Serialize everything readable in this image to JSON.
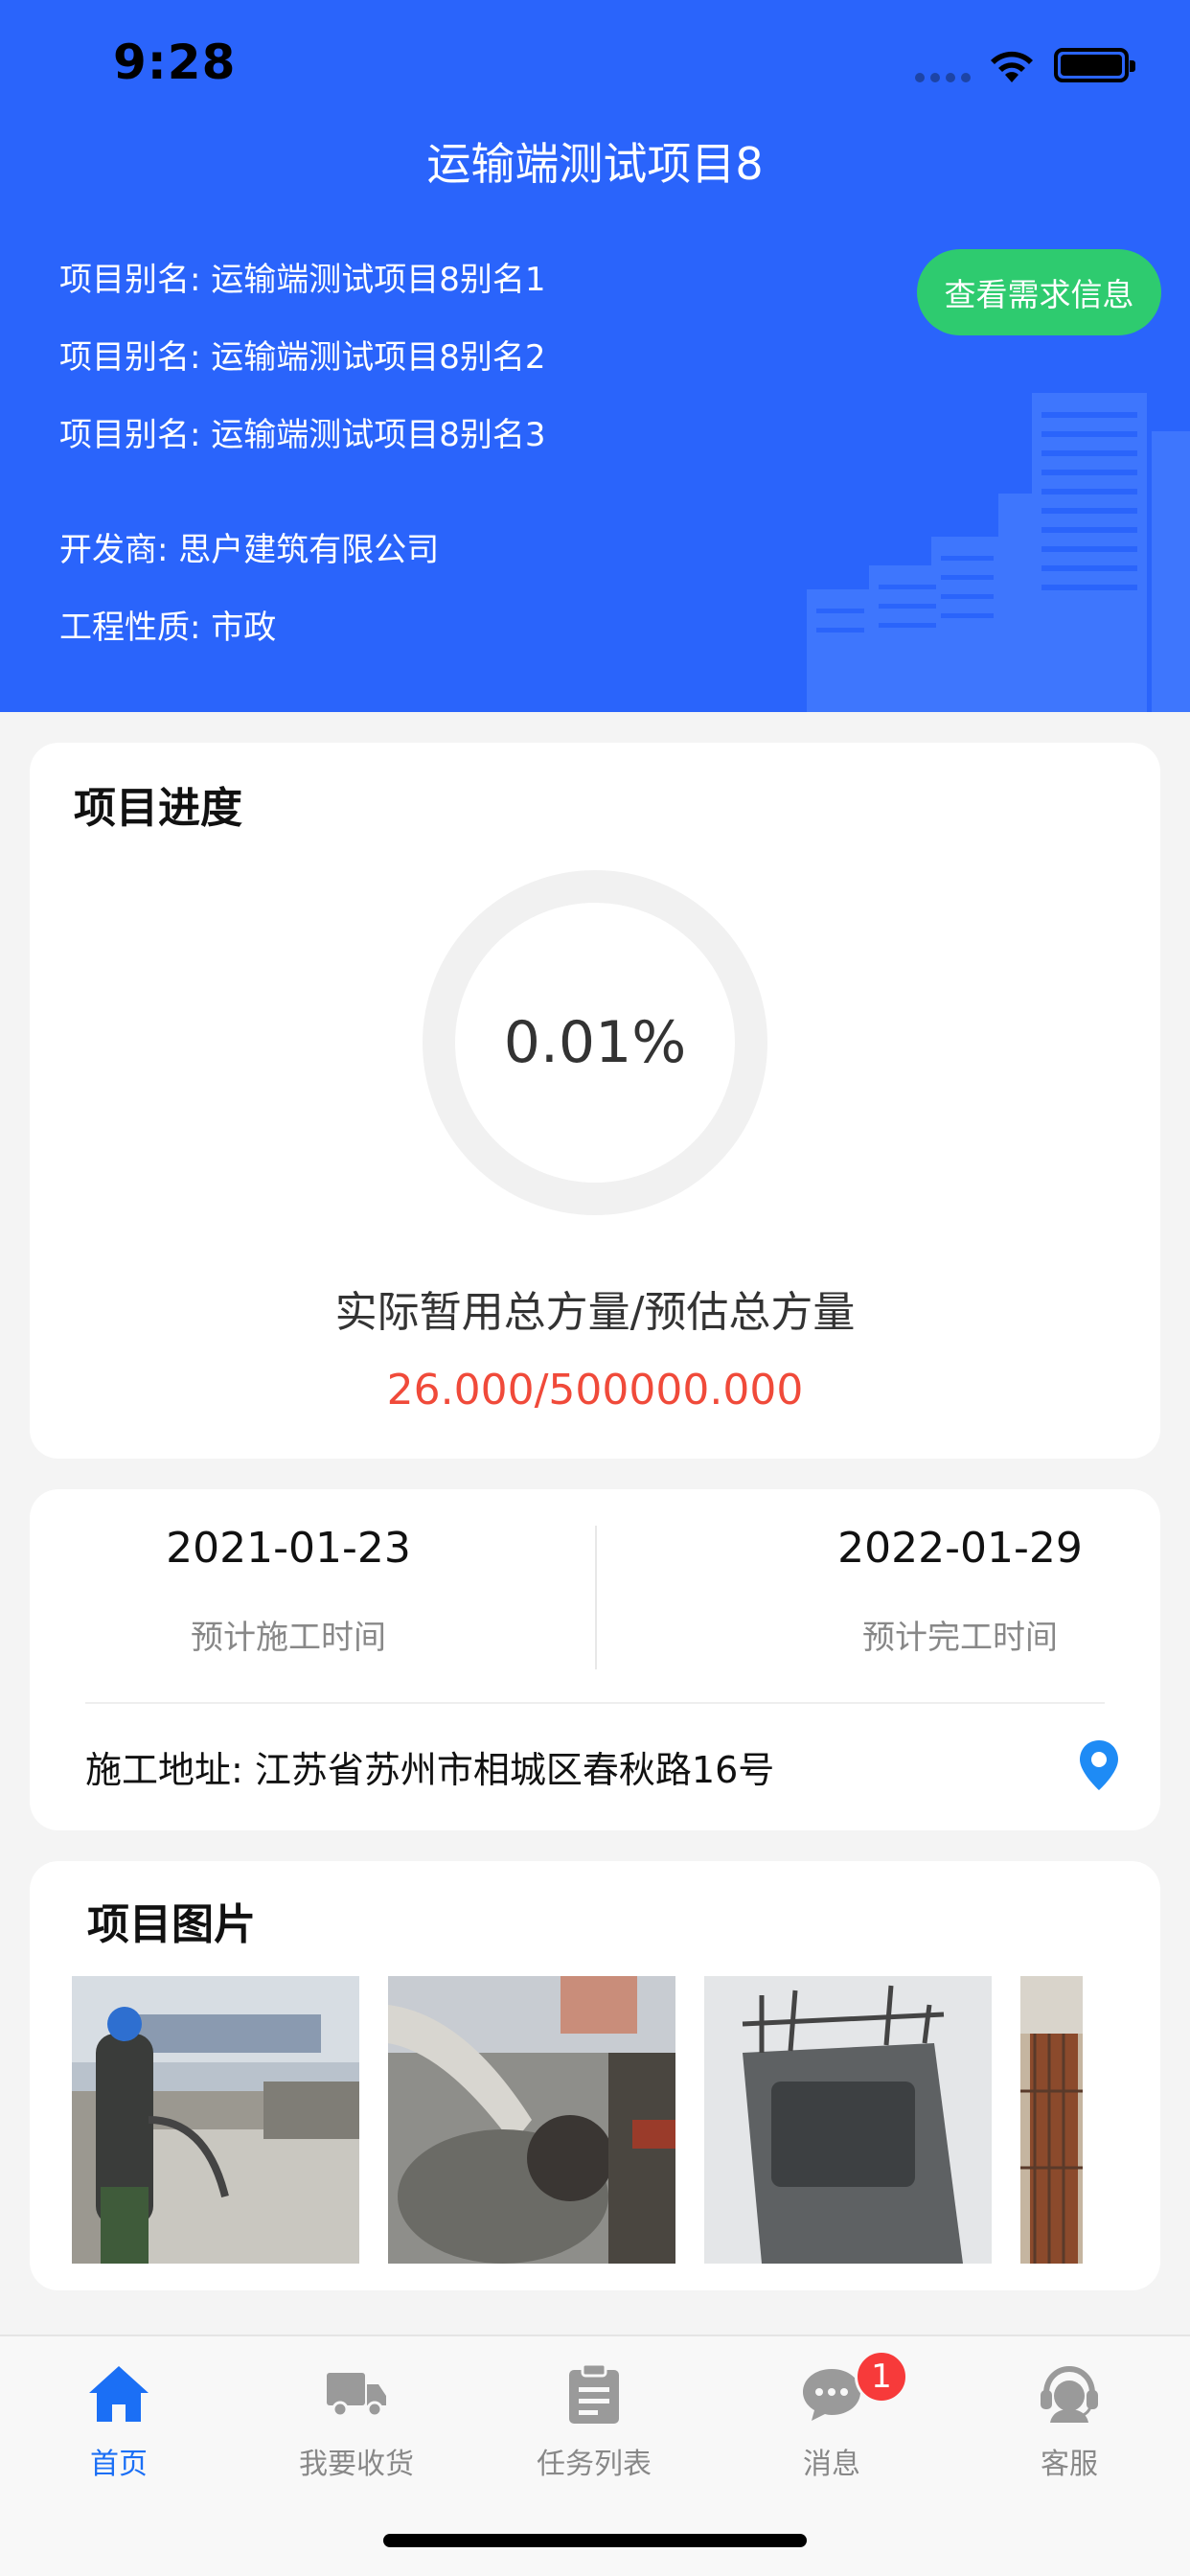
{
  "status_bar": {
    "time": "9:28"
  },
  "header": {
    "title": "运输端测试项目8",
    "aliases": [
      {
        "label": "项目别名:",
        "value": "运输端测试项目8别名1"
      },
      {
        "label": "项目别名:",
        "value": "运输端测试项目8别名2"
      },
      {
        "label": "项目别名:",
        "value": "运输端测试项目8别名3"
      }
    ],
    "developer": {
      "label": "开发商:",
      "value": "思户建筑有限公司"
    },
    "nature": {
      "label": "工程性质:",
      "value": "市政"
    },
    "demand_button": "查看需求信息",
    "accent_color": "#2a64fb"
  },
  "progress": {
    "title": "项目进度",
    "percent_text": "0.01%",
    "ratio_label": "实际暂用总方量/预估总方量",
    "ratio_value": "26.000/500000.000"
  },
  "schedule": {
    "start_date": "2021-01-23",
    "start_label": "预计施工时间",
    "end_date": "2022-01-29",
    "end_label": "预计完工时间",
    "address_label": "施工地址:",
    "address_value": "江苏省苏州市相城区春秋路16号",
    "pin_icon": "location-pin-icon"
  },
  "photos": {
    "title": "项目图片",
    "items": [
      {
        "name": "photo-worker-pouring"
      },
      {
        "name": "photo-concrete-pump"
      },
      {
        "name": "photo-precast-pier"
      },
      {
        "name": "photo-rebar-site"
      }
    ]
  },
  "tabbar": {
    "items": [
      {
        "label": "首页",
        "icon": "home-icon",
        "active": true
      },
      {
        "label": "我要收货",
        "icon": "truck-icon"
      },
      {
        "label": "任务列表",
        "icon": "clipboard-icon"
      },
      {
        "label": "消息",
        "icon": "chat-icon",
        "badge": "1"
      },
      {
        "label": "客服",
        "icon": "support-icon"
      }
    ],
    "active_color": "#1b6ff5"
  }
}
